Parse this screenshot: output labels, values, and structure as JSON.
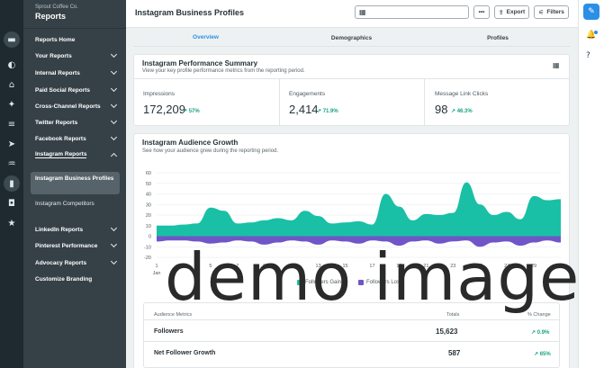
{
  "sidebar": {
    "company": "Sprout Coffee Co.",
    "title": "Reports",
    "items": [
      {
        "label": "Reports Home",
        "chevron": false
      },
      {
        "label": "Your Reports",
        "chevron": true
      },
      {
        "label": "Internal Reports",
        "chevron": true
      },
      {
        "label": "Paid Social Reports",
        "chevron": true
      },
      {
        "label": "Cross-Channel Reports",
        "chevron": true
      },
      {
        "label": "Twitter Reports",
        "chevron": true
      },
      {
        "label": "Facebook Reports",
        "chevron": true
      },
      {
        "label": "Instagram Reports",
        "chevron": true,
        "open": true
      },
      {
        "label": "LinkedIn Reports",
        "chevron": true
      },
      {
        "label": "Pinterest Performance",
        "chevron": true
      },
      {
        "label": "Advocacy Reports",
        "chevron": true
      },
      {
        "label": "Customize Branding",
        "chevron": false
      }
    ],
    "sub_active": "Instagram Business Profiles",
    "sub_other": "Instagram Competitors"
  },
  "rail_icons": [
    "folder-icon",
    "dashboard-icon",
    "inbox-icon",
    "pin-icon",
    "list-icon",
    "send-icon",
    "listening-icon",
    "reports-icon",
    "bot-icon",
    "star-icon"
  ],
  "header": {
    "title": "Instagram Business Profiles",
    "more_label": "•••",
    "export_label": "Export",
    "filters_label": "Filters"
  },
  "tabs": [
    "Overview",
    "Demographics",
    "Profiles"
  ],
  "summary": {
    "title": "Instagram Performance Summary",
    "subtitle": "View your key profile performance metrics from the reporting period.",
    "metrics": [
      {
        "label": "Impressions",
        "value": "172,209",
        "change": "↗ 57%"
      },
      {
        "label": "Engagements",
        "value": "2,414",
        "change": "↗ 71.9%"
      },
      {
        "label": "Message Link Clicks",
        "value": "98",
        "change": "↗ 46.3%"
      }
    ]
  },
  "growth": {
    "title": "Instagram Audience Growth",
    "subtitle": "See how your audience grew during the reporting period.",
    "legend": [
      "Followers Gained",
      "Followers Lost"
    ],
    "legend_partial": [
      "Followers Gained",
      "Followers Lost"
    ],
    "colors": {
      "gained": "#19c0a5",
      "lost": "#6f55c8"
    }
  },
  "chart_data": {
    "type": "area",
    "x": [
      1,
      2,
      3,
      4,
      5,
      6,
      7,
      8,
      9,
      10,
      11,
      12,
      13,
      14,
      15,
      16,
      17,
      18,
      19,
      20,
      21,
      22,
      23,
      24,
      25,
      26,
      27,
      28,
      29,
      30,
      31
    ],
    "x_tick_labels": [
      "1",
      "3",
      "5",
      "7",
      "9",
      "11",
      "13",
      "15",
      "17",
      "19",
      "21",
      "23",
      "25",
      "27",
      "29",
      "31"
    ],
    "x_sublabel": "Jan",
    "ylim": [
      -20,
      60
    ],
    "y_ticks": [
      -20,
      -10,
      0,
      10,
      20,
      30,
      40,
      50,
      60
    ],
    "series": [
      {
        "name": "Followers Gained",
        "values": [
          10,
          10,
          11,
          12,
          27,
          24,
          12,
          13,
          15,
          17,
          15,
          24,
          19,
          12,
          13,
          14,
          11,
          40,
          28,
          15,
          21,
          20,
          22,
          51,
          30,
          20,
          23,
          16,
          38,
          34,
          35
        ]
      },
      {
        "name": "Followers Lost",
        "values": [
          -5,
          -4,
          -4,
          -5,
          -7,
          -6,
          -4,
          -5,
          -8,
          -6,
          -4,
          -5,
          -8,
          -4,
          -5,
          -7,
          -4,
          -5,
          -9,
          -5,
          -4,
          -7,
          -5,
          -4,
          -10,
          -6,
          -5,
          -9,
          -6,
          -4,
          -6
        ]
      }
    ]
  },
  "metrics_table": {
    "headers": [
      "Audience Metrics",
      "Totals",
      "% Change"
    ],
    "rows": [
      {
        "label": "Followers",
        "total": "15,623",
        "change": "↗ 0.9%"
      },
      {
        "label": "Net Follower Growth",
        "total": "587",
        "change": "↗ 65%"
      }
    ]
  },
  "watermark": "demo image"
}
